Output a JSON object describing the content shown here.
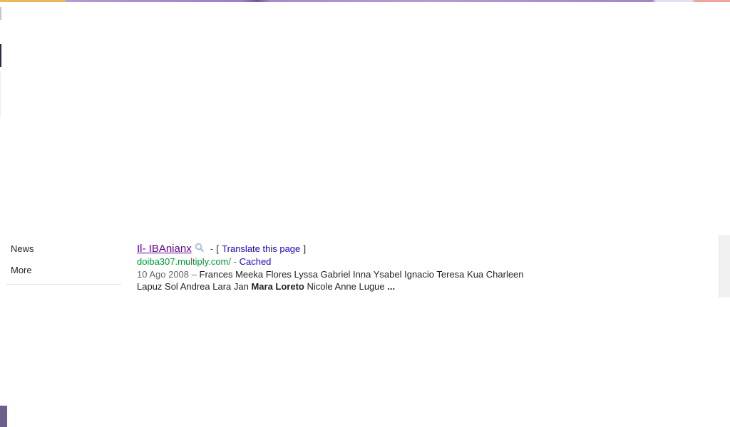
{
  "left_nav": {
    "items": [
      {
        "label": "News"
      },
      {
        "label": "More"
      }
    ]
  },
  "result": {
    "title": "Il- IBAnianx",
    "separator": "-",
    "translate_open": "[",
    "translate_label": "Translate this page",
    "translate_close": "]",
    "url": "doiba307.multiply.com/",
    "cached_separator": "-",
    "cached_label": "Cached",
    "date": "10 Ago 2008",
    "dash": "–",
    "snippet_before": "Frances Meeka Flores Lyssa Gabriel Inna Ysabel Ignacio Teresa Kua Charleen Lapuz Sol Andrea Lara Jan",
    "snippet_bold": "Mara Loreto",
    "snippet_after": "Nicole Anne Lugue",
    "snippet_ellipsis": "..."
  },
  "colors": {
    "visited_link": "#660099",
    "link": "#2200c1",
    "url_green": "#009933",
    "date_gray": "#666666"
  },
  "icons": {
    "magnifier": "magnifier-icon"
  }
}
